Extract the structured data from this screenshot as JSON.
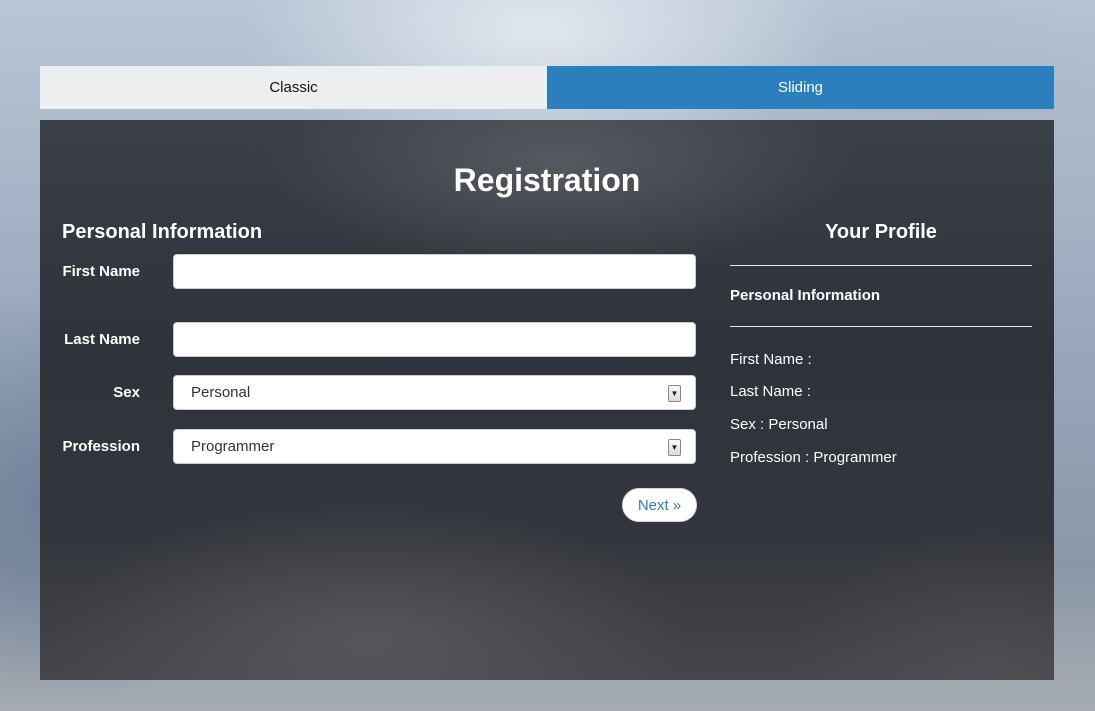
{
  "tabs": [
    {
      "label": "Classic",
      "active": false
    },
    {
      "label": "Sliding",
      "active": true
    }
  ],
  "form": {
    "title": "Registration",
    "section_title": "Personal Information",
    "fields": {
      "first_name": {
        "label": "First Name",
        "value": "",
        "placeholder": ""
      },
      "last_name": {
        "label": "Last Name",
        "value": "",
        "placeholder": ""
      },
      "sex": {
        "label": "Sex",
        "selected": "Personal",
        "arrow_icon": "select-arrow-icon"
      },
      "profession": {
        "label": "Profession",
        "selected": "Programmer",
        "arrow_icon": "select-arrow-icon"
      }
    },
    "next_button": "Next »"
  },
  "profile": {
    "title": "Your Profile",
    "section": "Personal Information",
    "lines": [
      "First Name :",
      "Last Name :",
      "Sex : Personal",
      "Profession : Programmer"
    ]
  },
  "colors": {
    "accent": "#2b7fbd",
    "panel_bg": "#2e333b",
    "tab_inactive_bg": "#eceeef"
  }
}
